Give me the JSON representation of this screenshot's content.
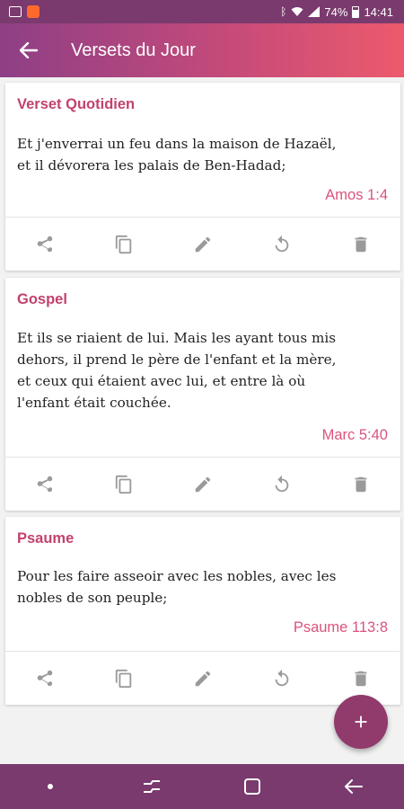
{
  "status_bar": {
    "battery": "74%",
    "time": "14:41"
  },
  "app_bar": {
    "title": "Versets du Jour"
  },
  "cards": [
    {
      "title": "Verset Quotidien",
      "lines": [
        "Et j'enverrai un feu dans la maison de Hazaël,",
        "et il dévorera les palais de Ben-Hadad;"
      ],
      "reference": "Amos 1:4"
    },
    {
      "title": "Gospel",
      "lines": [
        "Et ils se riaient de lui. Mais les ayant tous mis",
        "dehors, il prend le père de l'enfant et la mère,",
        "et ceux qui étaient avec lui, et entre là où",
        "l'enfant était couchée."
      ],
      "reference": "Marc 5:40"
    },
    {
      "title": "Psaume",
      "lines": [
        "Pour les faire asseoir avec les nobles, avec les",
        "nobles de son peuple;"
      ],
      "reference": "Psaume 113:8"
    }
  ],
  "actions": [
    "share-icon",
    "copy-icon",
    "edit-icon",
    "refresh-icon",
    "delete-icon"
  ],
  "colors": {
    "accent": "#c2426c",
    "reference": "#d9547d",
    "fab": "#913a6c",
    "bars": "#7a3a6e"
  }
}
